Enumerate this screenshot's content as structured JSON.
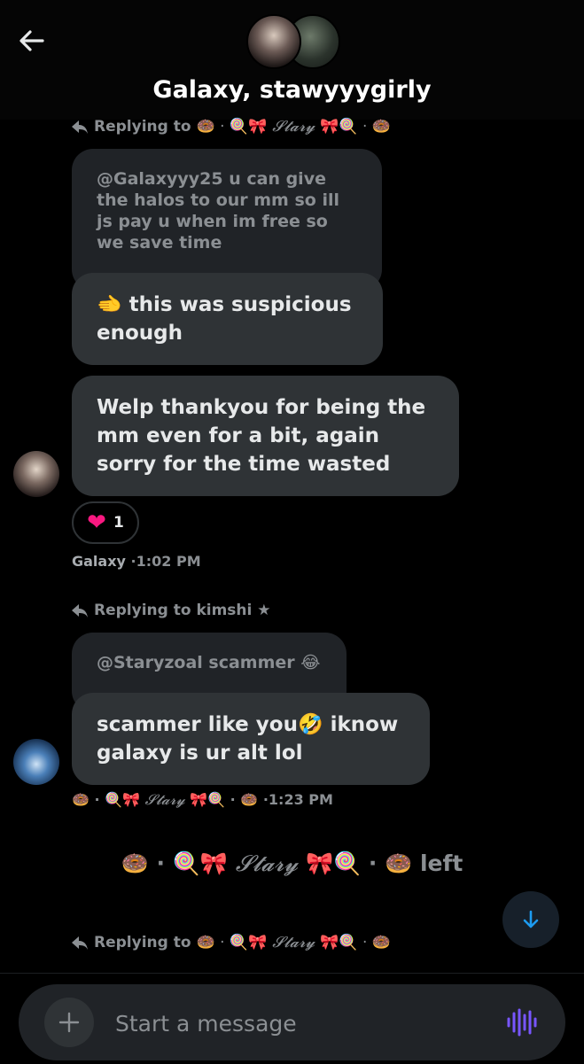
{
  "header": {
    "title": "Galaxy, stawyyygirly"
  },
  "thread": {
    "reply1": {
      "prefix": "Replying to",
      "deco_left": "🍩 · 🍭🎀",
      "stary": "𝓢𝓽𝓪𝓻𝔂",
      "deco_right": "🎀🍭 · 🍩"
    },
    "quoted1": "@Galaxyyy25 u can give the halos to our mm so ill js pay u when im free so we save time",
    "msg1": "🫲 this was suspicious enough",
    "msg2": "Welp thankyou for being the mm even for a bit, again sorry for the time wasted",
    "reaction": {
      "emoji": "❤",
      "count": "1"
    },
    "meta1": {
      "name": "Galaxy",
      "time": "·1:02 PM"
    },
    "reply2": {
      "prefix": "Replying to kimshi ★"
    },
    "quoted2": "@Staryzoal scammer 😂",
    "msg3": "scammer like you🤣 iknow galaxy is ur alt lol",
    "meta2": {
      "deco_left": "🍩 · 🍭🎀",
      "stary": "𝓢𝓽𝓪𝓻𝔂",
      "deco_right": "🎀🍭 · 🍩",
      "time": "·1:23 PM"
    },
    "system": {
      "deco_left": "🍩 · 🍭🎀",
      "stary": "𝓢𝓽𝓪𝓻𝔂",
      "deco_right": "🎀🍭 · 🍩",
      "action": "left"
    },
    "reply3": {
      "prefix": "Replying to",
      "deco_left": "🍩 · 🍭🎀",
      "stary": "𝓢𝓽𝓪𝓻𝔂",
      "deco_right": "🎀🍭 · 🍩"
    }
  },
  "composer": {
    "placeholder": "Start a message"
  },
  "icons": {
    "back": "arrow-left-icon",
    "reply": "reply-arrow-icon",
    "scroll": "arrow-down-icon",
    "add": "plus-icon",
    "voice": "voice-wave-icon"
  },
  "colors": {
    "accent": "#1d9bf0",
    "voice": "#7856ff",
    "bubble": "#2f3336",
    "quoted": "#202327"
  }
}
